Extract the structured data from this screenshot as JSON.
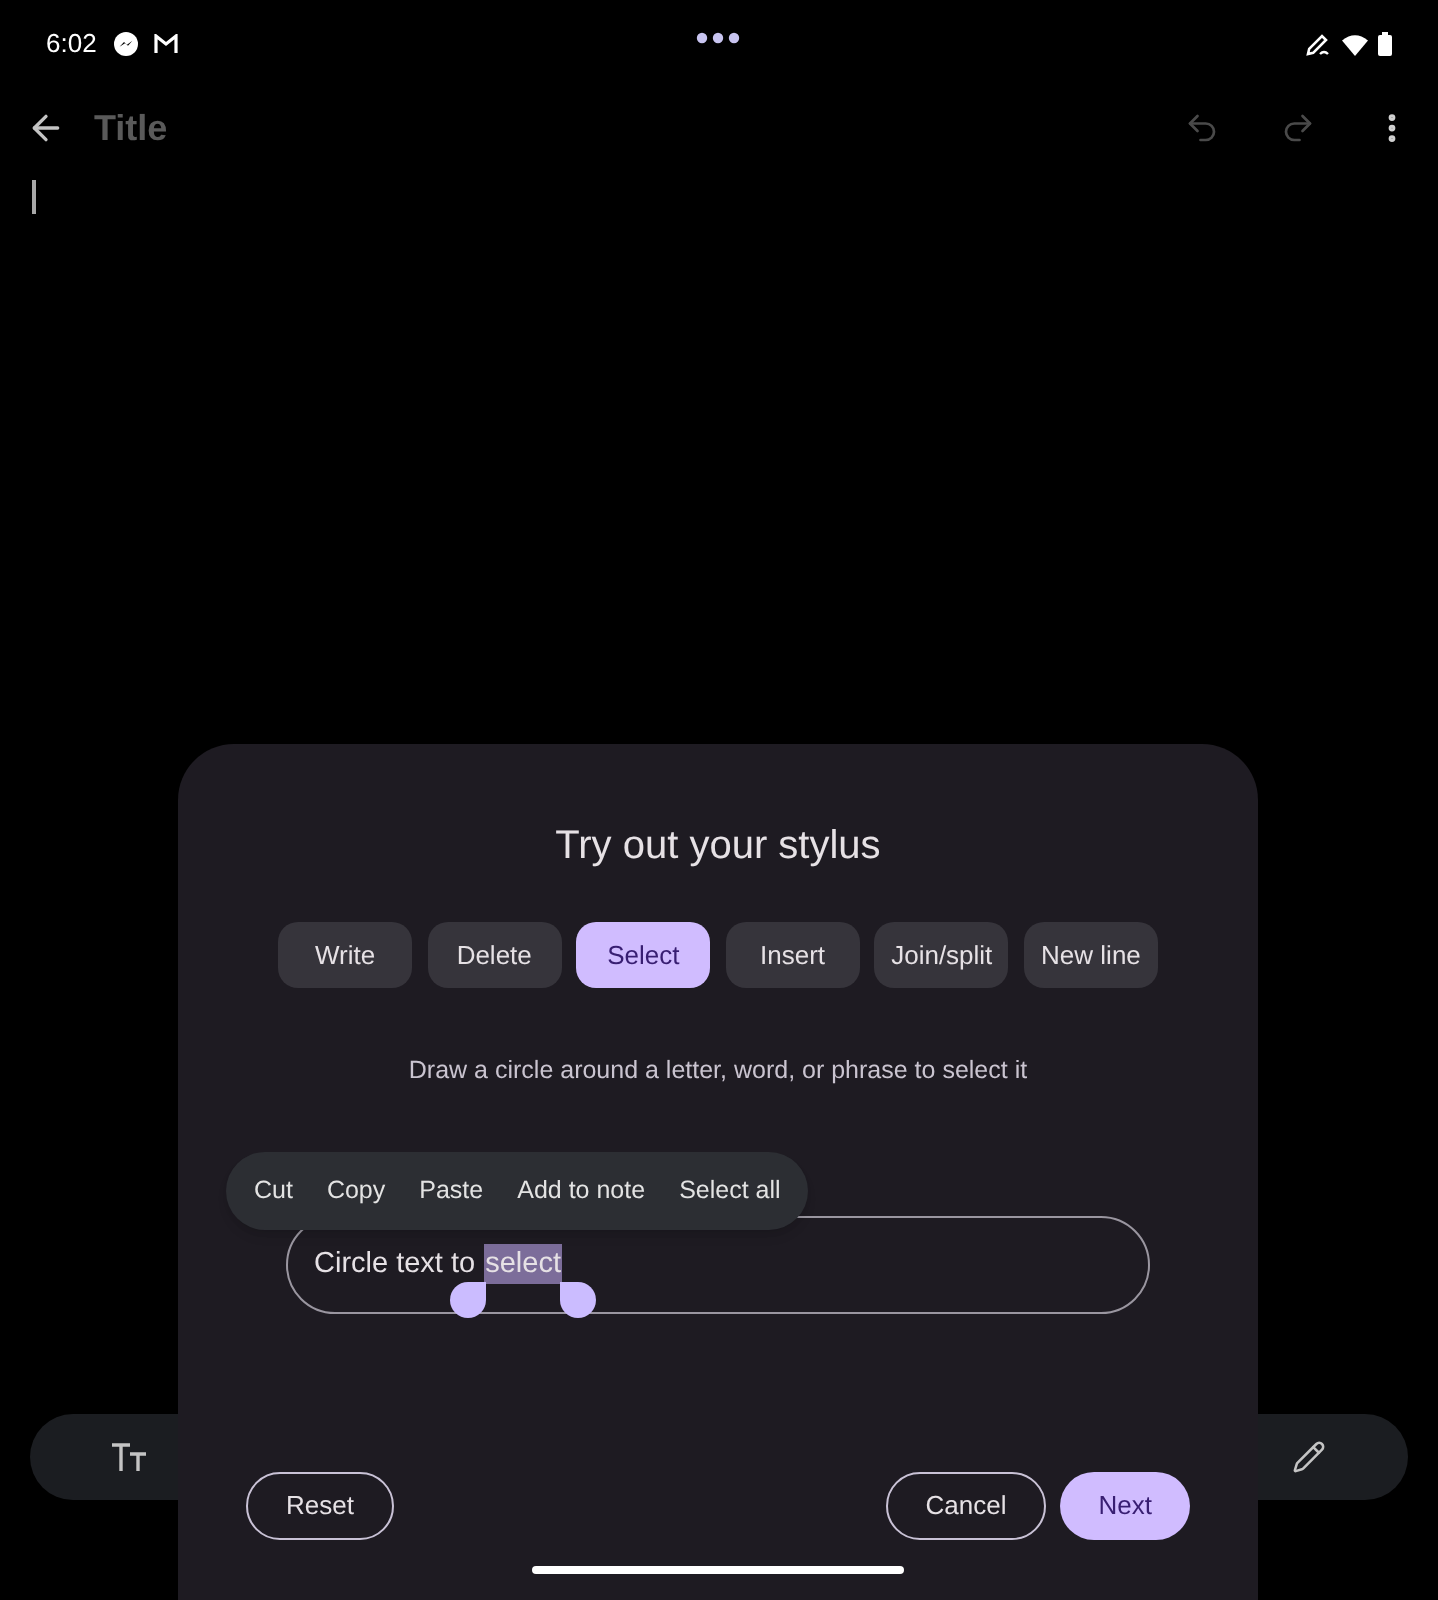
{
  "status_bar": {
    "time": "6:02"
  },
  "app_bar": {
    "title": "Title"
  },
  "sheet": {
    "title": "Try out your stylus",
    "modes": [
      {
        "label": "Write",
        "selected": false
      },
      {
        "label": "Delete",
        "selected": false
      },
      {
        "label": "Select",
        "selected": true
      },
      {
        "label": "Insert",
        "selected": false
      },
      {
        "label": "Join/split",
        "selected": false
      },
      {
        "label": "New line",
        "selected": false
      }
    ],
    "instruction": "Draw a circle around a letter, word, or phrase to select it",
    "context_menu": [
      "Cut",
      "Copy",
      "Paste",
      "Add to note",
      "Select all"
    ],
    "practice_field": {
      "text": "Circle text to",
      "selected_text": "select"
    },
    "buttons": [
      {
        "label": "Reset",
        "kind": "outlined"
      },
      {
        "label": "Cancel",
        "kind": "outlined"
      },
      {
        "label": "Next",
        "kind": "filled"
      }
    ]
  }
}
